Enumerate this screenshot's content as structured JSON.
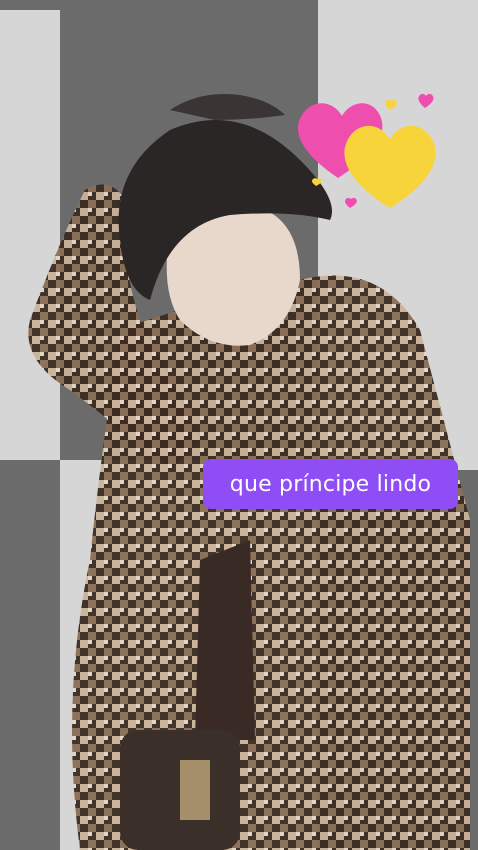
{
  "story": {
    "caption_sticker": "que príncipe lindo",
    "sticker_color": "#8e4df5",
    "hearts_sticker": "heart-sticker-icon",
    "heart_colors": [
      "#ee4fae",
      "#f8d43b"
    ]
  }
}
